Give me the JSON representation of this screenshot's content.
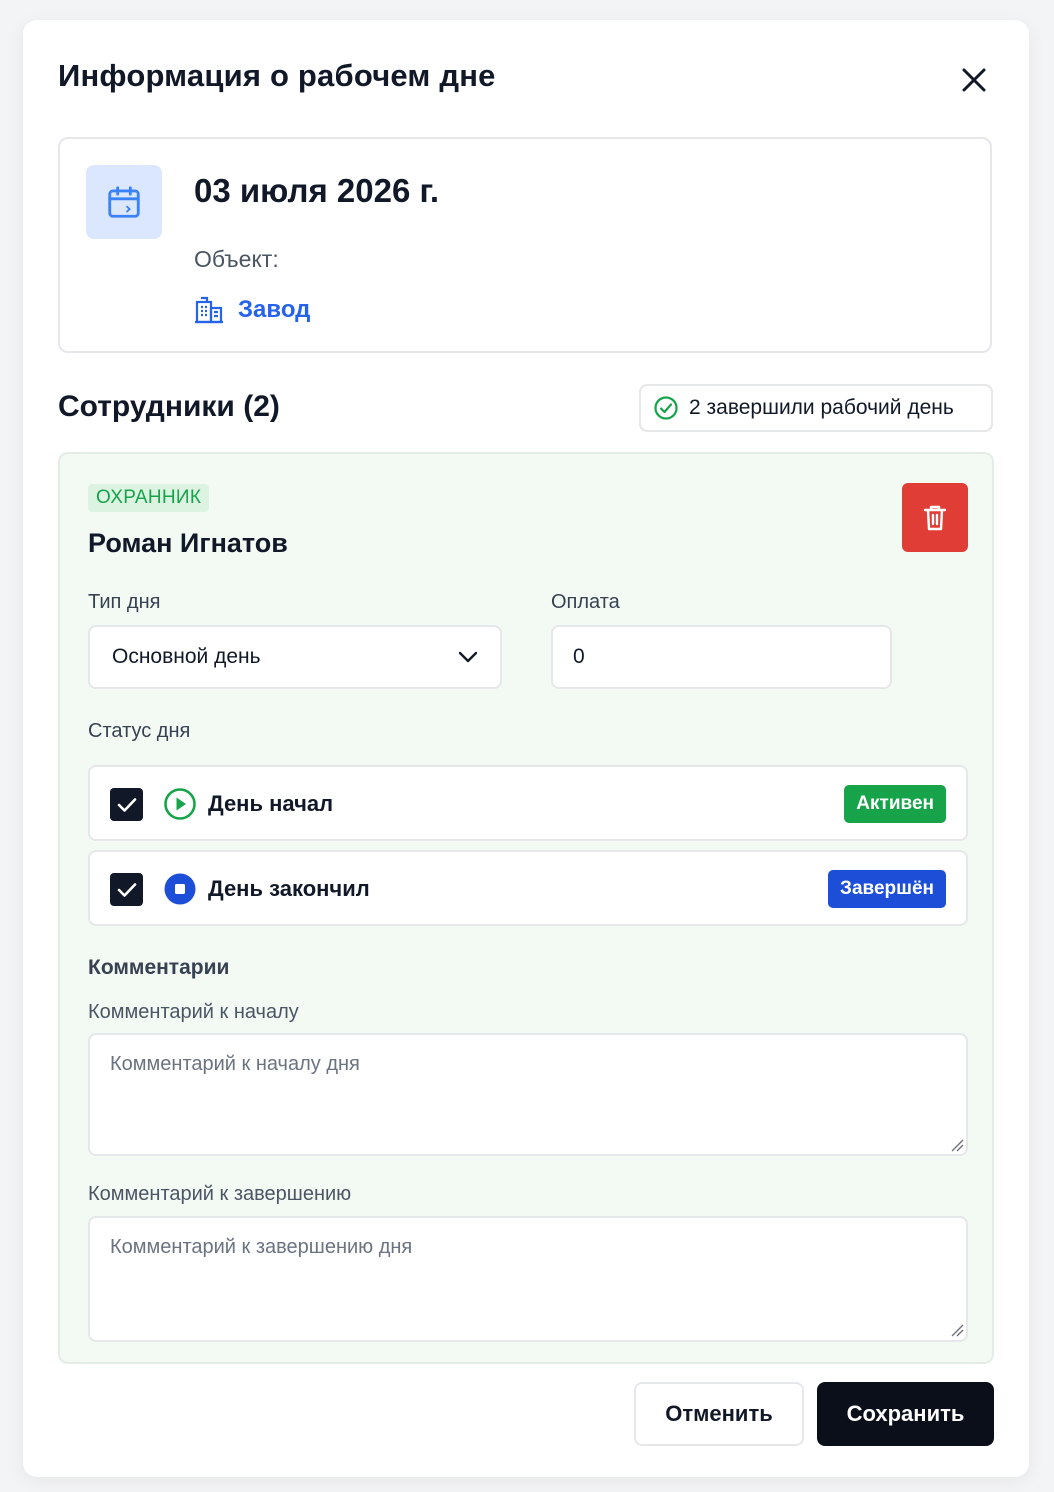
{
  "modal": {
    "title": "Информация о рабочем дне",
    "close_icon": "close-icon"
  },
  "info_card": {
    "calendar_icon": "calendar-icon",
    "date": "03 июля 2026 г.",
    "object_label": "Объект:",
    "object_icon": "building-icon",
    "object_name": "Завод"
  },
  "employees": {
    "title": "Сотрудники (2)",
    "done_badge_icon": "check-circle-icon",
    "done_badge_text": "2 завершили рабочий день"
  },
  "employee": {
    "role": "ОХРАННИК",
    "name": "Роман Игнатов",
    "delete_icon": "trash-icon",
    "day_type_label": "Тип дня",
    "day_type_value": "Основной день",
    "payment_label": "Оплата",
    "payment_value": "0",
    "status_label": "Статус дня",
    "statuses": [
      {
        "label": "День начал",
        "checked": true,
        "icon": "play-circle-icon",
        "badge": "Активен",
        "badge_color": "#16a34a"
      },
      {
        "label": "День закончил",
        "checked": true,
        "icon": "stop-circle-icon",
        "badge": "Завершён",
        "badge_color": "#1d4ed8"
      }
    ],
    "comments_title": "Комментарии",
    "start_comment_label": "Комментарий к началу",
    "start_comment_placeholder": "Комментарий к началу дня",
    "end_comment_label": "Комментарий к завершению",
    "end_comment_placeholder": "Комментарий к завершению дня"
  },
  "footer": {
    "cancel_label": "Отменить",
    "save_label": "Сохранить"
  },
  "colors": {
    "accent_blue": "#2563eb",
    "success_green": "#16a34a",
    "danger_red": "#e03d37",
    "primary_dark": "#0b0f19"
  }
}
